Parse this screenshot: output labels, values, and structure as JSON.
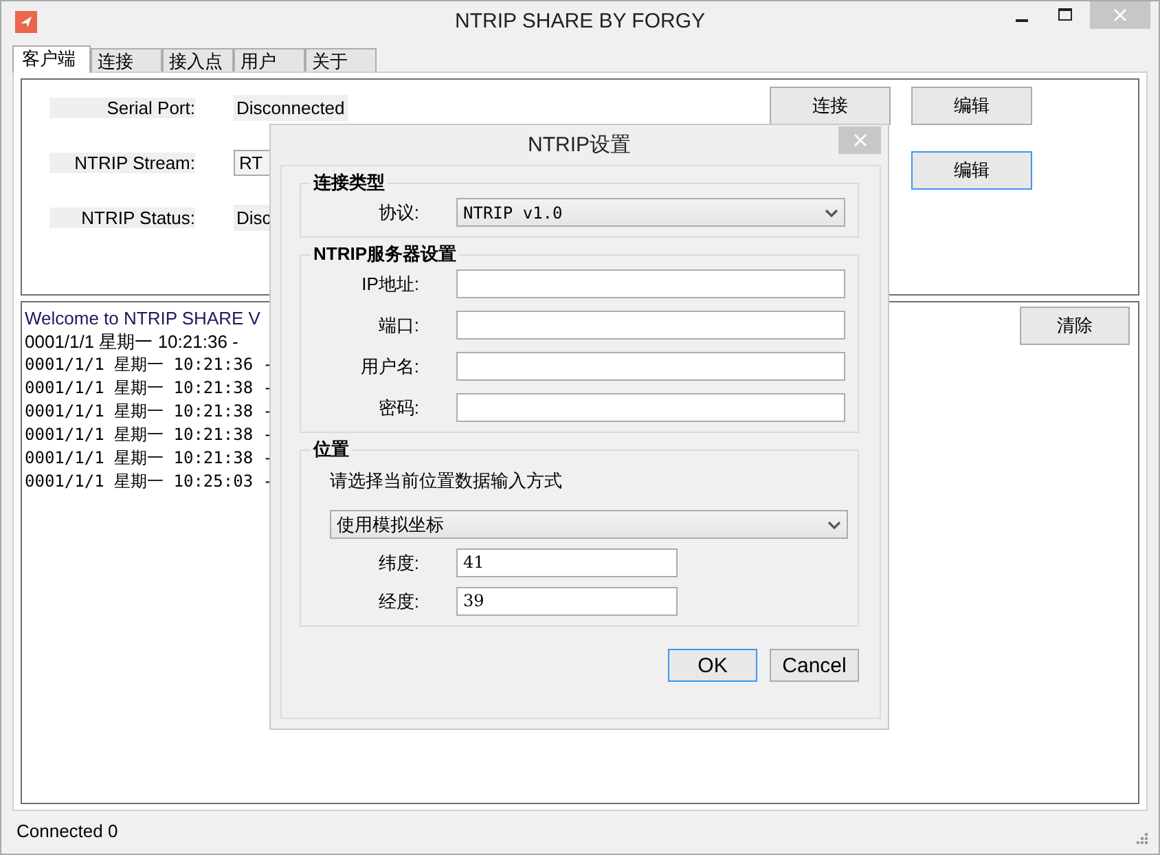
{
  "window": {
    "title": "NTRIP SHARE BY FORGY"
  },
  "tabs": [
    {
      "label": "客户端",
      "selected": true
    },
    {
      "label": "连接",
      "selected": false
    },
    {
      "label": "接入点",
      "selected": false
    },
    {
      "label": "用户",
      "selected": false
    },
    {
      "label": "关于",
      "selected": false
    }
  ],
  "client": {
    "fields": [
      {
        "label": "Serial Port:",
        "value": "Disconnected",
        "kind": "text"
      },
      {
        "label": "NTRIP Stream:",
        "value": "RT",
        "kind": "box"
      },
      {
        "label": "NTRIP Status:",
        "value": "Disc",
        "kind": "text"
      }
    ],
    "button_rows": [
      [
        {
          "label": "连接",
          "focused": false
        },
        {
          "label": "编辑",
          "focused": false
        }
      ],
      [
        {
          "label": "编辑",
          "focused": true
        }
      ]
    ]
  },
  "log": {
    "lines": [
      {
        "text": "Welcome to NTRIP SHARE V",
        "kind": "sans"
      },
      {
        "text": "0001/1/1 星期一 10:21:36 -",
        "kind": "sans"
      },
      {
        "text": "0001/1/1 星期一 10:21:36 -",
        "kind": "mono"
      },
      {
        "text": "0001/1/1 星期一 10:21:38 -",
        "kind": "mono"
      },
      {
        "text": "0001/1/1 星期一 10:21:38 -",
        "kind": "mono"
      },
      {
        "text": "0001/1/1 星期一 10:21:38 -",
        "kind": "mono"
      },
      {
        "text": "0001/1/1 星期一 10:21:38 -",
        "kind": "mono"
      },
      {
        "text": "0001/1/1 星期一 10:25:03 -",
        "kind": "mono"
      }
    ],
    "clear_button": "清除"
  },
  "status_bar": {
    "text": "Connected 0"
  },
  "dialog": {
    "title": "NTRIP设置",
    "groups": [
      {
        "kind": "protocol",
        "title": "连接类型",
        "label": "协议:",
        "value": "NTRIP v1.0"
      },
      {
        "kind": "fields",
        "title": "NTRIP服务器设置",
        "fields": [
          {
            "label": "IP地址:"
          },
          {
            "label": "端口:"
          },
          {
            "label": "用户名:"
          },
          {
            "label": "密码:"
          }
        ]
      },
      {
        "kind": "location",
        "title": "位置",
        "prompt": "请选择当前位置数据输入方式",
        "mode": "使用模拟坐标",
        "fields": [
          {
            "label": "纬度:",
            "value": "41"
          },
          {
            "label": "经度:",
            "value": "39"
          }
        ]
      }
    ],
    "buttons": [
      {
        "label": "OK",
        "focused": true
      },
      {
        "label": "Cancel",
        "focused": false
      }
    ]
  }
}
